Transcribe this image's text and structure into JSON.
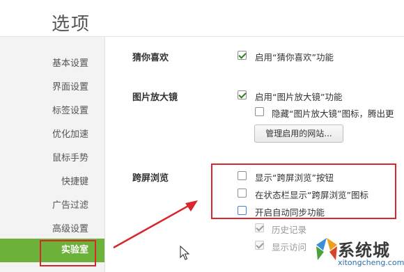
{
  "window": {
    "title": "选项"
  },
  "sidebar": {
    "items": [
      {
        "label": "基本设置",
        "active": false
      },
      {
        "label": "界面设置",
        "active": false
      },
      {
        "label": "标签设置",
        "active": false
      },
      {
        "label": "优化加速",
        "active": false
      },
      {
        "label": "鼠标手势",
        "active": false
      },
      {
        "label": "快捷键",
        "active": false
      },
      {
        "label": "广告过滤",
        "active": false
      },
      {
        "label": "高级设置",
        "active": false
      },
      {
        "label": "实验室",
        "active": true
      }
    ],
    "active_color": "#6cb13a"
  },
  "sections": {
    "guess": {
      "title": "猜你喜欢",
      "options": [
        {
          "label": "启用“猜你喜欢”功能",
          "checked": true
        }
      ]
    },
    "magnifier": {
      "title": "图片放大镜",
      "options": [
        {
          "label": "启用“图片放大镜”功能",
          "checked": true
        },
        {
          "label": "隐藏“图片放大镜”图标，腾出更",
          "checked": false
        }
      ],
      "manage_button": "管理启用的网站..."
    },
    "crossscreen": {
      "title": "跨屏浏览",
      "options": [
        {
          "label": "显示“跨屏浏览”按钮",
          "checked": false
        },
        {
          "label": "在状态栏显示“跨屏浏览”图标",
          "checked": false
        },
        {
          "label": "开启自动同步功能",
          "checked": false
        }
      ],
      "sub_options": [
        {
          "label": "历史记录",
          "checked": true,
          "disabled": true
        },
        {
          "label": "显示访问",
          "checked": true,
          "disabled": true
        }
      ]
    }
  },
  "annotations": {
    "highlight_color": "#d9252c"
  },
  "watermark": {
    "site": "系统城",
    "url": "xitongcheng.com"
  }
}
